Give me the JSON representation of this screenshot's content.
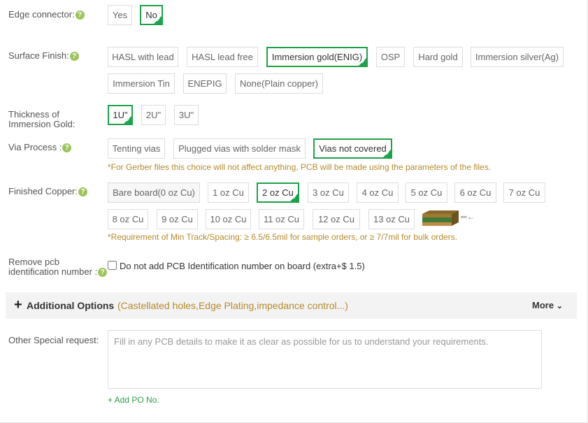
{
  "edge_connector": {
    "label": "Edge connector:",
    "options": [
      "Yes",
      "No"
    ]
  },
  "surface_finish": {
    "label": "Surface Finish:",
    "options": [
      "HASL with lead",
      "HASL lead free",
      "Immersion gold(ENIG)",
      "OSP",
      "Hard gold",
      "Immersion silver(Ag)",
      "Immersion Tin",
      "ENEPIG",
      "None(Plain copper)"
    ]
  },
  "thickness": {
    "label_line1": "Thickness of",
    "label_line2": "Immersion Gold:",
    "options": [
      "1U\"",
      "2U\"",
      "3U\""
    ]
  },
  "via_process": {
    "label": "Via Process :",
    "options": [
      "Tenting vias",
      "Plugged vias with solder mask",
      "Vias not covered"
    ],
    "note": "*For Gerber files this choice will not affect anything, PCB will be made using the parameters of the files."
  },
  "finished_copper": {
    "label": "Finished Copper:",
    "options": [
      "Bare board(0 oz Cu)",
      "1 oz Cu",
      "2 oz Cu",
      "3 oz Cu",
      "4 oz Cu",
      "5 oz Cu",
      "6 oz Cu",
      "7 oz Cu",
      "8 oz Cu",
      "9 oz Cu",
      "10 oz Cu",
      "11 oz Cu",
      "12 oz Cu",
      "13 oz Cu"
    ],
    "arrow": "═←",
    "note": "*Requirement of Min Track/Spacing: ≥ 6.5/6.5mil for sample orders, or ≥ 7/7mil for bulk orders."
  },
  "remove_id": {
    "label_line1": "Remove pcb",
    "label_line2": "identification number :",
    "checkbox_label": "Do not add PCB Identification number on board (extra+$ 1.5)"
  },
  "additional": {
    "plus": "+",
    "title": "Additional Options",
    "subtitle": "(Castellated holes,Edge Plating,impedance control...)",
    "more": "More"
  },
  "special": {
    "label": "Other Special request:",
    "placeholder": "Fill in any PCB details to make it as clear as possible for us to understand your requirements.",
    "po_link": "+ Add PO No."
  },
  "help_glyph": "?",
  "check_glyph": "✓",
  "chevron": "⌄",
  "colors": {
    "accent": "#1aa34a",
    "note": "#b48a2c",
    "help": "#9cc55a"
  }
}
